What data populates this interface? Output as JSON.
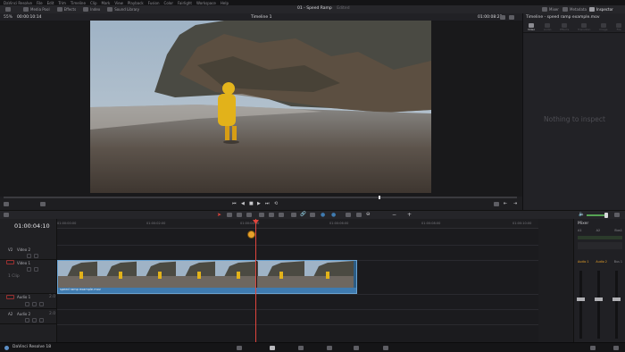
{
  "menubar": {
    "app_name": "DaVinci Resolve",
    "items": [
      "File",
      "Edit",
      "Trim",
      "Timeline",
      "Clip",
      "Mark",
      "View",
      "Playback",
      "Fusion",
      "Color",
      "Fairlight",
      "Workspace",
      "Help"
    ]
  },
  "toolbar": {
    "media_pool": "Media Pool",
    "effects": "Effects",
    "index": "Index",
    "sound_library": "Sound Library",
    "project_title": "01 - Speed Ramp",
    "project_status": "Edited",
    "mixer": "Mixer",
    "metadata": "Metadata",
    "inspector": "Inspector"
  },
  "viewer": {
    "zoom": "55%",
    "source_timecode": "00:00:10:14",
    "timeline_name": "Timeline 1",
    "timeline_timecode": "01:00:08:23"
  },
  "inspector": {
    "title": "Timeline - speed ramp example.mov",
    "tabs": [
      "Video",
      "Audio",
      "Effects",
      "Transition",
      "Image",
      "File"
    ],
    "empty_message": "Nothing to inspect"
  },
  "timeline": {
    "current_timecode": "01:00:04:10",
    "ruler": [
      "01:00:00:00",
      "01:00:02:00",
      "01:00:04:00",
      "01:00:06:00",
      "01:00:08:00",
      "01:00:10:00"
    ],
    "tracks": [
      {
        "id": "V2",
        "name": "Video 2",
        "clips": ""
      },
      {
        "id": "V1",
        "name": "Video 1",
        "clips": "1 Clip"
      },
      {
        "id": "A1",
        "name": "Audio 1",
        "channel": "2.0"
      },
      {
        "id": "A2",
        "name": "Audio 2",
        "channel": "2.0"
      }
    ],
    "clip_name": "speed ramp example.mov"
  },
  "mixer": {
    "title": "Mixer",
    "channels": [
      "A1",
      "A2",
      "Bus1"
    ],
    "strips": [
      "Audio 1",
      "Audio 2",
      "Bus 1"
    ]
  },
  "bottombar": {
    "app_label": "DaVinci Resolve 18"
  },
  "colors": {
    "playhead": "#e0453c",
    "clip_blue": "#3f7bb0",
    "accent_orange": "#e8a12a"
  }
}
